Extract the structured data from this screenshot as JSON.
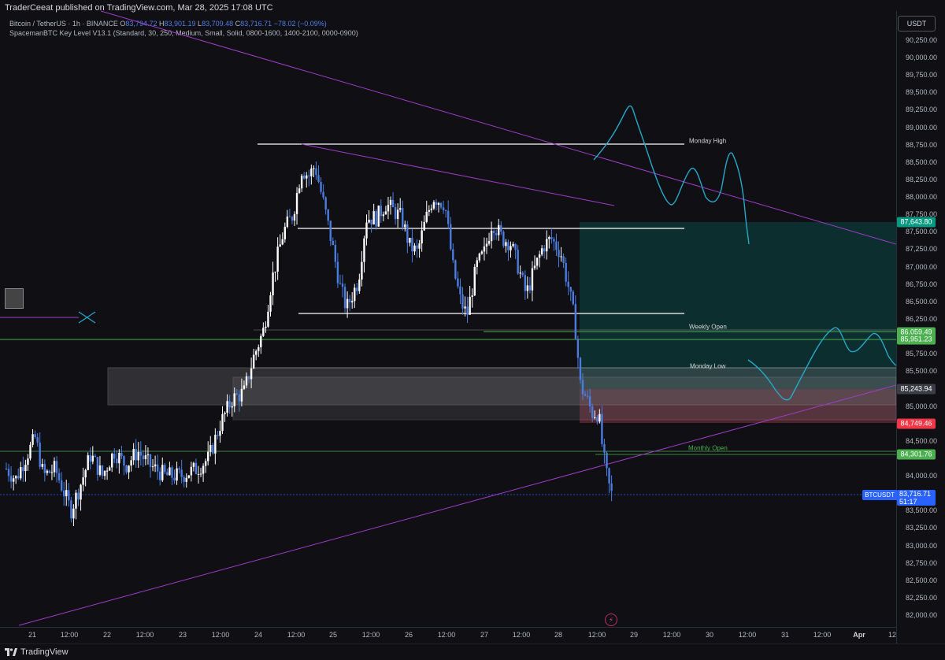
{
  "header": {
    "published_by": "TraderCeeat published on TradingView.com, Mar 28, 2025 17:08 UTC"
  },
  "legend": {
    "symbol": "Bitcoin / TetherUS · 1h · BINANCE",
    "o_label": "O",
    "o_value": "83,794.72",
    "h_label": "H",
    "h_value": "83,901.19",
    "l_label": "L",
    "l_value": "83,709.48",
    "c_label": "C",
    "c_value": "83,716.71",
    "change": "−78.02 (−0.09%)",
    "indicator": "SpacemanBTC Key Level V13.1 (Standard, 30, 250, Medium, Small, Solid, 0800-1600, 1400-2100, 0000-0900)"
  },
  "price_axis": {
    "currency": "USDT",
    "ticks": [
      "90,250.00",
      "90,000.00",
      "89,750.00",
      "89,500.00",
      "89,250.00",
      "89,000.00",
      "88,750.00",
      "88,500.00",
      "88,250.00",
      "88,000.00",
      "87,750.00",
      "87,500.00",
      "87,250.00",
      "87,000.00",
      "86,750.00",
      "86,500.00",
      "86,250.00",
      "85,750.00",
      "85,500.00",
      "85,000.00",
      "84,500.00",
      "84,000.00",
      "83,500.00",
      "83,250.00",
      "83,000.00",
      "82,750.00",
      "82,500.00",
      "82,250.00",
      "82,000.00"
    ],
    "tags": [
      {
        "text": "87,643.80",
        "color": "#089981"
      },
      {
        "text": "86,059.49",
        "color": "#4caf50"
      },
      {
        "text": "85,951.23",
        "color": "#4caf50"
      },
      {
        "text": "85,243.94",
        "color": "#3b3e47"
      },
      {
        "text": "84,749.46",
        "color": "#f23645"
      },
      {
        "text": "84,301.76",
        "color": "#4caf50"
      }
    ],
    "last_symbol": "BTCUSDT",
    "last_price": "83,716.71",
    "countdown": "51:17"
  },
  "time_axis": {
    "labels": [
      "21",
      "12:00",
      "22",
      "12:00",
      "23",
      "12:00",
      "24",
      "12:00",
      "25",
      "12:00",
      "26",
      "12:00",
      "27",
      "12:00",
      "28",
      "12:00",
      "29",
      "12:00",
      "30",
      "12:00",
      "31",
      "12:00",
      "Apr",
      "12"
    ]
  },
  "levels": {
    "monday_high": "Monday High",
    "weekly_open": "Weekly Open",
    "monday_low": "Monday Low",
    "monthly_open": "Monthly Open"
  },
  "footer": {
    "brand": "TradingView"
  },
  "colors": {
    "bull": "#ffffff",
    "bear": "#4a7ddf",
    "trendline": "#a03cc8",
    "projection": "#26a8c8",
    "level_green": "#4caf50",
    "target_zone": "#0c3a37",
    "stop_zone": "#5a2632"
  }
}
